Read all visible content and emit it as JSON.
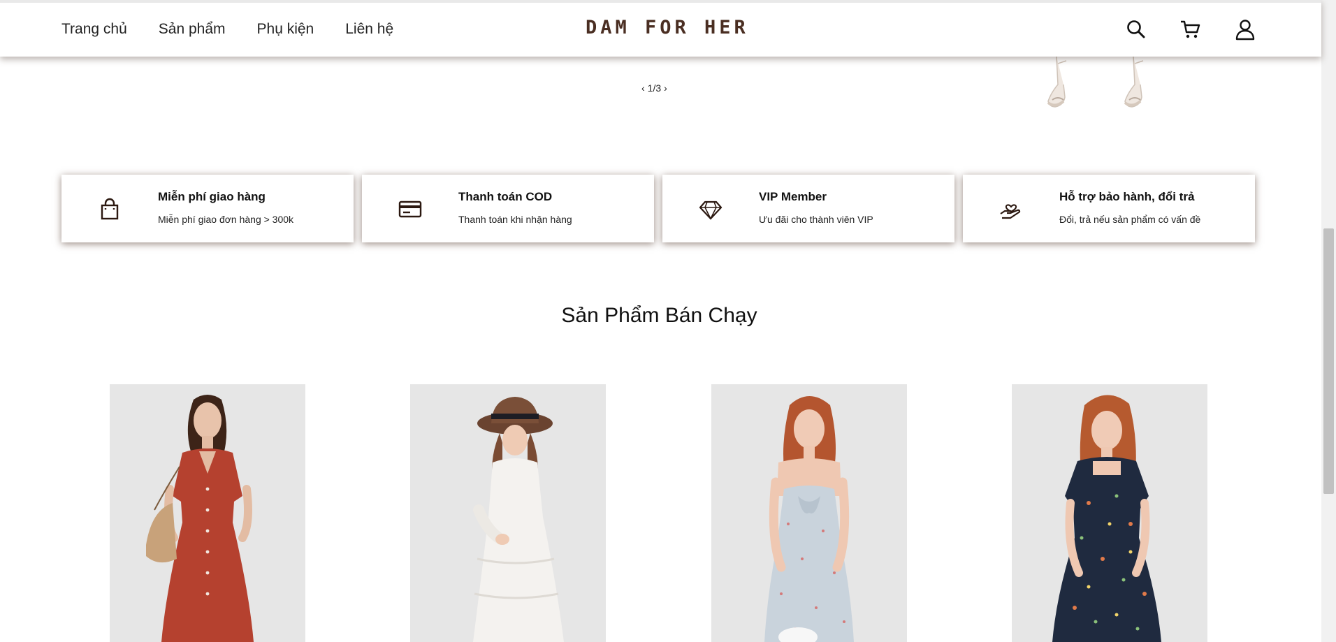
{
  "header": {
    "nav": [
      "Trang chủ",
      "Sản phẩm",
      "Phụ kiện",
      "Liên hệ"
    ],
    "logo": "DAM FOR HER",
    "icons": [
      "search-icon",
      "cart-icon",
      "user-icon"
    ]
  },
  "slider": {
    "pager": "1/3",
    "prev": "‹",
    "next": "›"
  },
  "features": [
    {
      "icon": "shopping-bag-icon",
      "title": "Miễn phí giao hàng",
      "subtitle": "Miễn phí giao đơn hàng > 300k"
    },
    {
      "icon": "credit-card-icon",
      "title": "Thanh toán COD",
      "subtitle": "Thanh toán khi nhận hàng"
    },
    {
      "icon": "diamond-icon",
      "title": "VIP Member",
      "subtitle": "Ưu đãi cho thành viên VIP"
    },
    {
      "icon": "hand-heart-icon",
      "title": "Hỗ trợ bảo hành, đổi trả",
      "subtitle": "Đổi, trả nếu sản phẩm có vấn đề"
    }
  ],
  "bestsellers": {
    "title": "Sản Phẩm Bán Chạy",
    "products": [
      {
        "image": "red-button-dress-photo",
        "dress_color": "#b5412f"
      },
      {
        "image": "white-lace-dress-photo",
        "dress_color": "#f4f2ef"
      },
      {
        "image": "floral-slip-dress-photo",
        "dress_color": "#c9d3dc"
      },
      {
        "image": "navy-floral-dress-photo",
        "dress_color": "#1f2a3f"
      }
    ]
  },
  "colors": {
    "brand": "#4a2e22",
    "card_shadow": "#46281a"
  }
}
